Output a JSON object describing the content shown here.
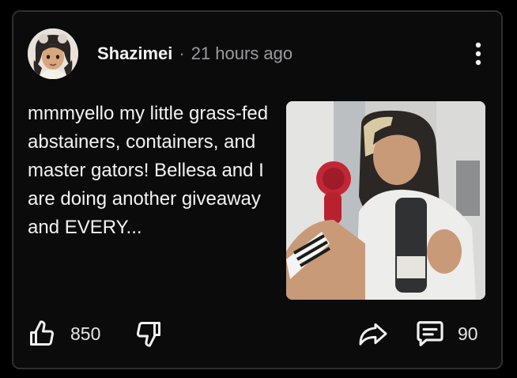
{
  "post": {
    "username": "Shazimei",
    "separator": "·",
    "time_ago": "21 hours ago",
    "text": "mmmyello my little grass-fed abstainers, containers, and master gators! Bellesa and I are doing another giveaway and EVERY...",
    "upvotes": "850",
    "comments": "90"
  },
  "icons": {
    "menu": "more-vertical-icon",
    "upvote": "thumbs-up-icon",
    "downvote": "thumbs-down-icon",
    "share": "share-arrow-icon",
    "comments": "comment-icon"
  },
  "colors": {
    "background": "#000000",
    "card": "#0b0b0c",
    "border": "#2e2f31",
    "text": "#f3f3f3",
    "muted": "#9a9b9d"
  }
}
